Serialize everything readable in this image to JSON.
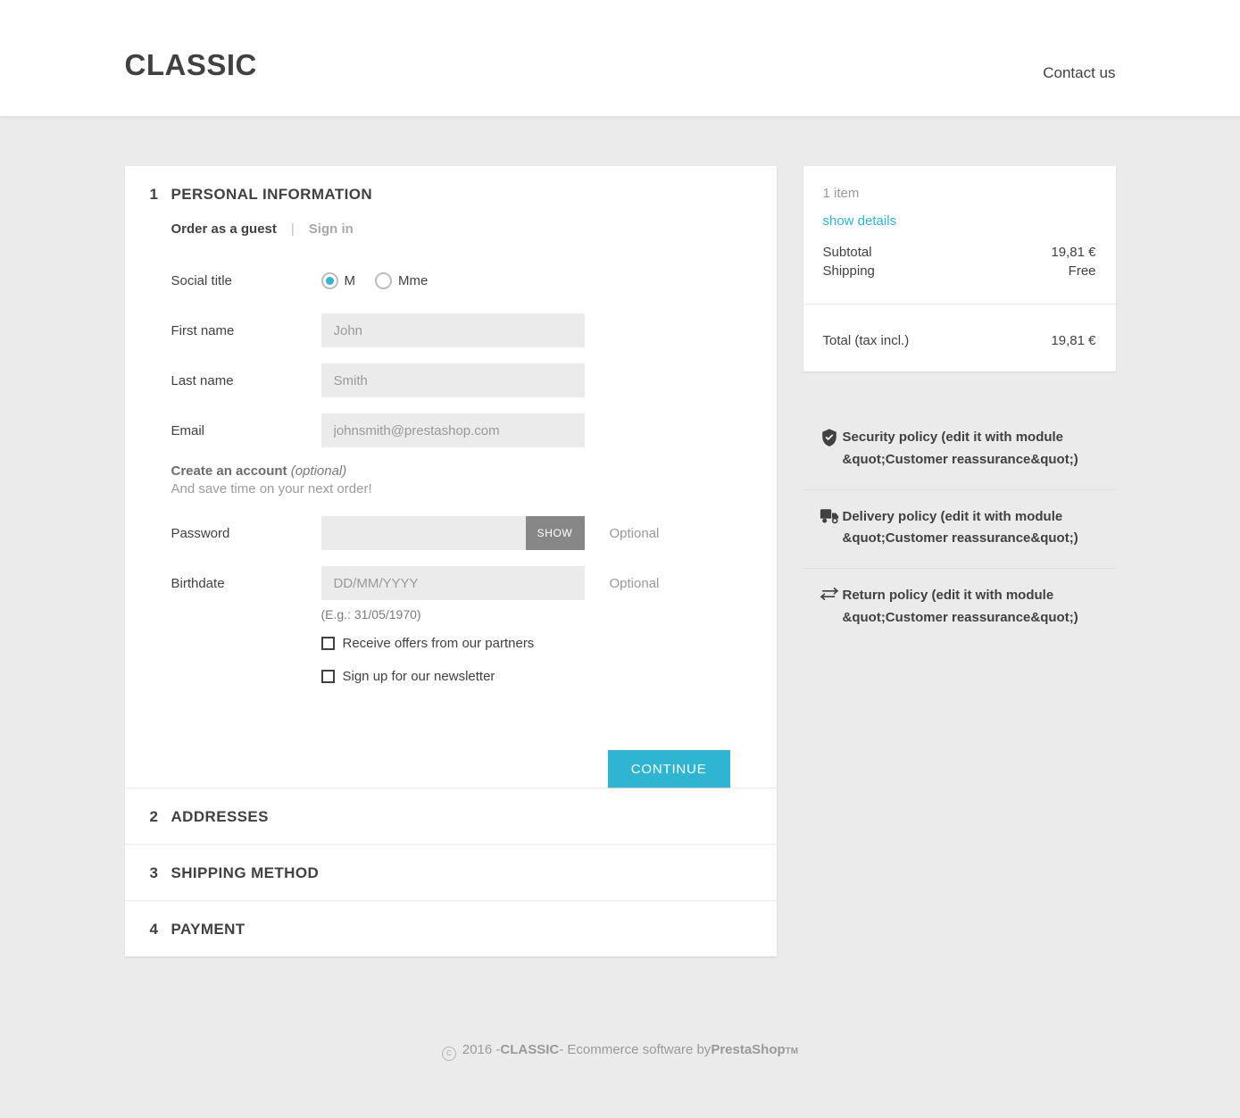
{
  "header": {
    "brand": "CLASSIC",
    "contact_link": "Contact us"
  },
  "steps": [
    {
      "num": "1",
      "title": "PERSONAL INFORMATION"
    },
    {
      "num": "2",
      "title": "ADDRESSES"
    },
    {
      "num": "3",
      "title": "SHIPPING METHOD"
    },
    {
      "num": "4",
      "title": "PAYMENT"
    }
  ],
  "personal_information": {
    "tab_guest": "Order as a guest",
    "tab_separator": "|",
    "tab_signin": "Sign in",
    "social_title": {
      "label": "Social title",
      "options": [
        {
          "label": "M",
          "checked": true
        },
        {
          "label": "Mme",
          "checked": false
        }
      ]
    },
    "first_name": {
      "label": "First name",
      "placeholder": "John",
      "value": ""
    },
    "last_name": {
      "label": "Last name",
      "placeholder": "Smith",
      "value": ""
    },
    "email": {
      "label": "Email",
      "placeholder": "johnsmith@prestashop.com",
      "value": ""
    },
    "create_account": {
      "title": "Create an account",
      "optional_note": "(optional)",
      "subtitle": "And save time on your next order!"
    },
    "password": {
      "label": "Password",
      "placeholder": "",
      "value": "",
      "show_button": "SHOW",
      "suffix": "Optional"
    },
    "birthdate": {
      "label": "Birthdate",
      "placeholder": "DD/MM/YYYY",
      "value": "",
      "suffix": "Optional",
      "hint": "(E.g.: 31/05/1970)"
    },
    "checkboxes": [
      {
        "label": "Receive offers from our partners",
        "checked": false
      },
      {
        "label": "Sign up for our newsletter",
        "checked": false
      }
    ],
    "continue_button": "CONTINUE"
  },
  "cart_summary": {
    "item_count": "1 item",
    "show_details": "show details",
    "lines": [
      {
        "label": "Subtotal",
        "value": "19,81 €"
      },
      {
        "label": "Shipping",
        "value": "Free"
      }
    ],
    "total_label": "Total (tax incl.)",
    "total_value": "19,81 €"
  },
  "reassurance": [
    {
      "icon": "shield-check-icon",
      "text": "Security policy (edit it with module &quot;Customer reassurance&quot;)"
    },
    {
      "icon": "truck-icon",
      "text": "Delivery policy (edit it with module &quot;Customer reassurance&quot;)"
    },
    {
      "icon": "exchange-arrows-icon",
      "text": "Return policy (edit it with module &quot;Customer reassurance&quot;)"
    }
  ],
  "footer": {
    "copyright_symbol": "c",
    "year": "2016 - ",
    "shop_name": "CLASSIC",
    "tail": " - Ecommerce software by ",
    "platform": "PrestaShop",
    "tm": "TM"
  },
  "colors": {
    "accent": "#2fb5d2",
    "page_bg": "#ebebeb",
    "card_bg": "#ffffff",
    "text": "#414141",
    "muted": "#9a9a9a",
    "show_button": "#878787"
  }
}
